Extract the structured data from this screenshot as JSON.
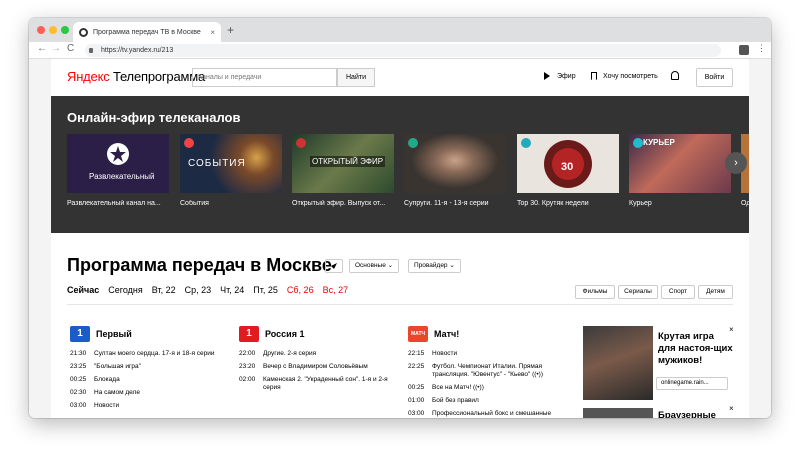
{
  "browser": {
    "tab_title": "Программа передач ТВ в Москве",
    "tab_close": "×",
    "new_tab": "+",
    "url": "https://tv.yandex.ru/213",
    "back": "←",
    "forward": "→",
    "reload": "C",
    "menu": "⋮"
  },
  "header": {
    "logo_brand": "Яндекс",
    "logo_service": "Телепрограмма",
    "search_placeholder": "Каналы и передачи",
    "search_button": "Найти",
    "live_label": "Эфир",
    "watchlist_label": "Хочу посмотреть",
    "login_label": "Войти"
  },
  "live": {
    "title": "Онлайн-эфир телеканалов",
    "next_arrow": "›",
    "cards": [
      {
        "caption": "Развлекательный канал на...",
        "thumb_text": "Развлекательный",
        "bg": "#2b1f47"
      },
      {
        "caption": "События",
        "thumb_text": "СОБЫТИЯ",
        "bg": "#1d2a44"
      },
      {
        "caption": "Открытый эфир. Выпуск от...",
        "thumb_text": "ОТКРЫТЫЙ ЭФИР",
        "bg": "#2d4a2d"
      },
      {
        "caption": "Супруги. 11-я - 13-я серии",
        "thumb_text": "",
        "bg": "#3a3430"
      },
      {
        "caption": "Top 30. Крутяк недели",
        "thumb_text": "30",
        "bg": "#e9e4de"
      },
      {
        "caption": "Курьер",
        "thumb_text": "КУРЬЕР",
        "bg": "#6b3a4c"
      },
      {
        "caption": "Од",
        "thumb_text": "",
        "bg": "#b5733a"
      }
    ]
  },
  "schedule": {
    "title": "Программа передач в Москве",
    "filter_main": "Основные",
    "filter_provider": "Провайдер",
    "days": [
      {
        "label": "Сейчас",
        "style": "cur"
      },
      {
        "label": "Сегодня",
        "style": ""
      },
      {
        "label": "Вт, 22",
        "style": ""
      },
      {
        "label": "Ср, 23",
        "style": ""
      },
      {
        "label": "Чт, 24",
        "style": ""
      },
      {
        "label": "Пт, 25",
        "style": ""
      },
      {
        "label": "Сб, 26",
        "style": "red"
      },
      {
        "label": "Вс, 27",
        "style": "red"
      }
    ],
    "genres": [
      "Фильмы",
      "Сериалы",
      "Спорт",
      "Детям"
    ],
    "channels": [
      {
        "name": "Первый",
        "logo": "1",
        "logo_color": "#1c5cc7",
        "programs": [
          {
            "time": "21:30",
            "title": "Султан моего сердца. 17-я и 18-я серии"
          },
          {
            "time": "23:25",
            "title": "\"Большая игра\""
          },
          {
            "time": "00:25",
            "title": "Блокада"
          },
          {
            "time": "02:30",
            "title": "На самом деле"
          },
          {
            "time": "03:00",
            "title": "Новости"
          }
        ]
      },
      {
        "name": "Россия 1",
        "logo": "1",
        "logo_color": "#e11b22",
        "programs": [
          {
            "time": "22:00",
            "title": "Другие. 2-я серия"
          },
          {
            "time": "23:20",
            "title": "Вечер с Владимиром Соловьёвым"
          },
          {
            "time": "02:00",
            "title": "Каменская 2. \"Украденный сон\". 1-я и 2-я серия"
          }
        ]
      },
      {
        "name": "Матч!",
        "logo": "МАТЧ",
        "logo_color": "#e8472e",
        "programs": [
          {
            "time": "22:15",
            "title": "Новости"
          },
          {
            "time": "22:25",
            "title": "Футбол. Чемпионат Италии. Прямая трансляция. \"Ювентус\" - \"Кьево\" ((•))"
          },
          {
            "time": "00:25",
            "title": "Все на Матч! ((•))"
          },
          {
            "time": "01:00",
            "title": "Бой без правил"
          },
          {
            "time": "03:00",
            "title": "Профессиональный бокс и смешанные"
          }
        ]
      }
    ]
  },
  "ad": {
    "title": "Крутая игра для настоя-щих мужиков!",
    "domain": "onlinegame.rain...",
    "close": "×",
    "title2": "Браузерные"
  }
}
